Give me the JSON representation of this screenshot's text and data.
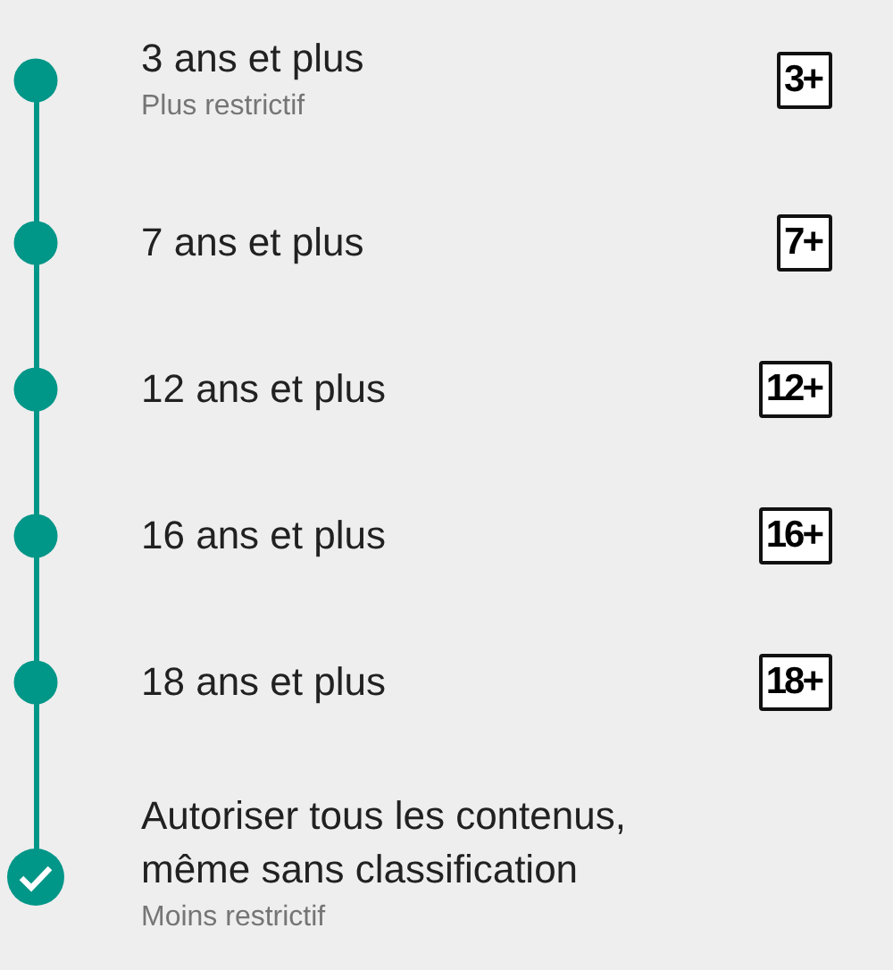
{
  "levels": [
    {
      "title": "3 ans et plus",
      "subtitle": "Plus restrictif",
      "badge": "3+",
      "selected": false
    },
    {
      "title": "7 ans et plus",
      "badge": "7+",
      "selected": false
    },
    {
      "title": "12 ans et plus",
      "badge": "12+",
      "selected": false
    },
    {
      "title": "16 ans et plus",
      "badge": "16+",
      "selected": false
    },
    {
      "title": "18 ans et plus",
      "badge": "18+",
      "selected": false
    },
    {
      "title": "Autoriser tous les contenus,\nmême sans classification",
      "subtitle": "Moins restrictif",
      "selected": true
    }
  ]
}
